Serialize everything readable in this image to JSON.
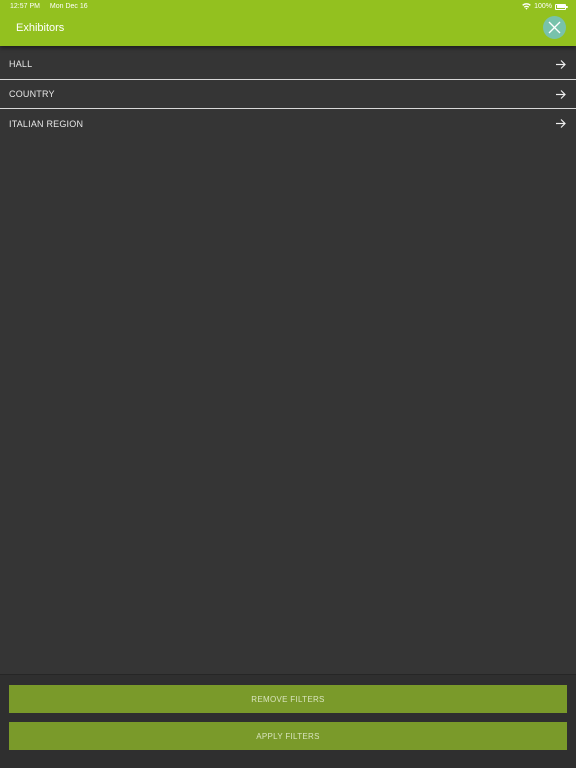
{
  "status_bar": {
    "time": "12:57 PM",
    "date": "Mon Dec 16",
    "battery": "100%",
    "wifi_icon": "wifi-icon",
    "battery_icon": "battery-icon"
  },
  "header": {
    "title": "Exhibitors",
    "close_icon": "close-icon"
  },
  "filters": [
    {
      "label": "HALL",
      "icon": "arrow-right-icon"
    },
    {
      "label": "COUNTRY",
      "icon": "arrow-right-icon"
    },
    {
      "label": "ITALIAN REGION",
      "icon": "arrow-right-icon"
    }
  ],
  "footer": {
    "remove_label": "REMOVE FILTERS",
    "apply_label": "APPLY FILTERS"
  },
  "colors": {
    "header": "#93c11f",
    "close_button": "#78c2ab",
    "background": "#353535",
    "action_button": "#7a9a2a"
  }
}
